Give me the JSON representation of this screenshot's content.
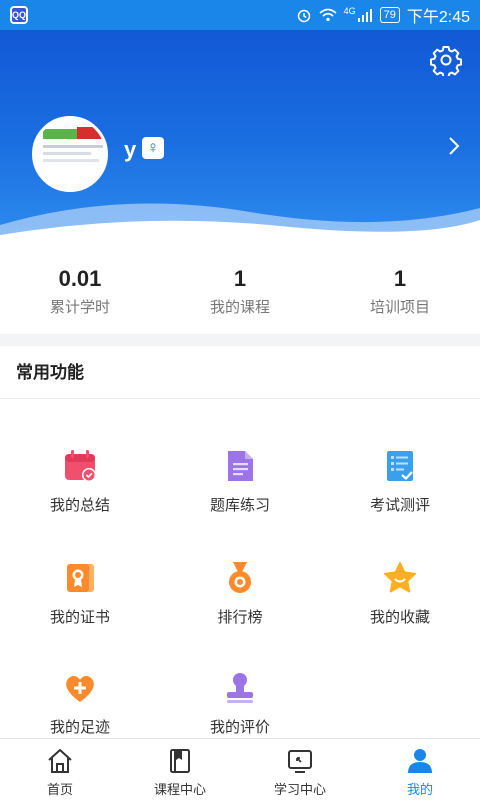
{
  "status_bar": {
    "app_icon_text": "QQ",
    "network": "4G",
    "battery": "79",
    "time": "下午2:45"
  },
  "profile": {
    "username": "y",
    "gender_symbol": "♀"
  },
  "stats": [
    {
      "value": "0.01",
      "label": "累计学时"
    },
    {
      "value": "1",
      "label": "我的课程"
    },
    {
      "value": "1",
      "label": "培训项目"
    }
  ],
  "section": {
    "title": "常用功能"
  },
  "features": [
    {
      "label": "我的总结",
      "icon": "calendar-check-icon",
      "color": "#f0506e"
    },
    {
      "label": "题库练习",
      "icon": "document-icon",
      "color": "#9b74e6"
    },
    {
      "label": "考试测评",
      "icon": "exam-list-icon",
      "color": "#3aa0ee"
    },
    {
      "label": "我的证书",
      "icon": "certificate-icon",
      "color": "#ff8a2b"
    },
    {
      "label": "排行榜",
      "icon": "medal-icon",
      "color": "#ff8a2b"
    },
    {
      "label": "我的收藏",
      "icon": "star-icon",
      "color": "#ffb020"
    },
    {
      "label": "我的足迹",
      "icon": "heart-plus-icon",
      "color": "#ff8a2b"
    },
    {
      "label": "我的评价",
      "icon": "stamp-icon",
      "color": "#9b74e6"
    }
  ],
  "tabs": [
    {
      "label": "首页",
      "icon": "home-icon",
      "active": false
    },
    {
      "label": "课程中心",
      "icon": "book-icon",
      "active": false
    },
    {
      "label": "学习中心",
      "icon": "learning-screen-icon",
      "active": false
    },
    {
      "label": "我的",
      "icon": "user-icon",
      "active": true
    }
  ],
  "colors": {
    "accent": "#1a86ea",
    "header_top": "#1259d6",
    "header_bottom": "#2f8ef0"
  }
}
